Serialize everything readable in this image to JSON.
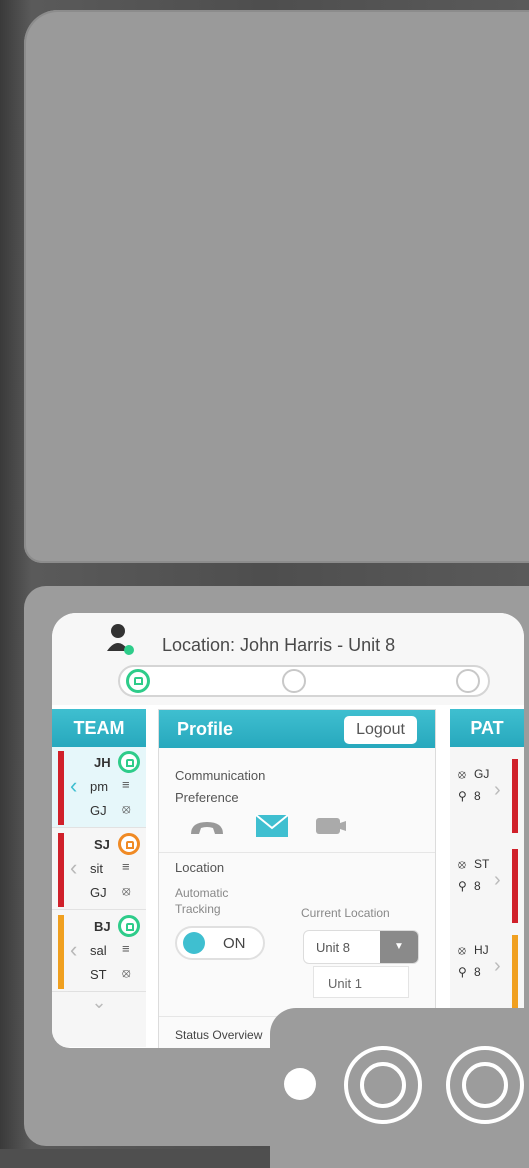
{
  "header": {
    "location_title": "Location: John Harris - Unit 8"
  },
  "team": {
    "title": "TEAM",
    "members": [
      {
        "initials": "JH",
        "line2": "pm",
        "line3": "GJ",
        "status_color": "#2ecc8a",
        "flag_color": "#d0202a"
      },
      {
        "initials": "SJ",
        "line2": "sit",
        "line3": "GJ",
        "status_color": "#f08a24",
        "flag_color": "#d0202a"
      },
      {
        "initials": "BJ",
        "line2": "sal",
        "line3": "ST",
        "status_color": "#2ecc8a",
        "flag_color": "#f0a020"
      }
    ]
  },
  "profile": {
    "title": "Profile",
    "logout_label": "Logout",
    "communication_label": "Communication",
    "preference_label": "Preference",
    "icons": [
      "phone-icon",
      "mail-icon",
      "chat-icon"
    ],
    "location_label": "Location",
    "automatic_label": "Automatic",
    "tracking_label": "Tracking",
    "toggle_label": "ON",
    "current_location_label": "Current Location",
    "current_location_value": "Unit 8",
    "dropdown_option": "Unit 1",
    "status_overview_label": "Status Overview"
  },
  "patients": {
    "title": "PAT",
    "items": [
      {
        "initials": "GJ",
        "room": "8",
        "flag_color": "#d0202a"
      },
      {
        "initials": "ST",
        "room": "8",
        "flag_color": "#d0202a"
      },
      {
        "initials": "HJ",
        "room": "8",
        "flag_color": "#f0a020"
      }
    ]
  },
  "colors": {
    "accent": "#3fbfd0",
    "active": "#2ecc8a"
  }
}
